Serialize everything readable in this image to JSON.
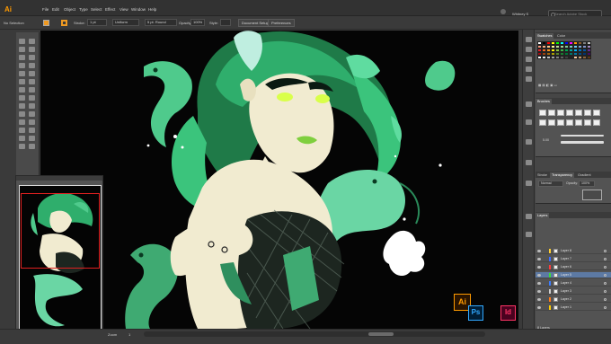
{
  "app": {
    "logo": "Ai"
  },
  "menu": [
    "File",
    "Edit",
    "Object",
    "Type",
    "Select",
    "Effect",
    "View",
    "Window",
    "Help"
  ],
  "header": {
    "user": "Whitney S",
    "search_placeholder": "Search Adobe Stock"
  },
  "control_bar": {
    "selection": "No Selection",
    "stroke_label": "Stroke:",
    "stroke_value": "1 pt",
    "profile": "Uniform",
    "brush": "5 pt. Round",
    "opacity_label": "Opacity:",
    "opacity_value": "100%",
    "style_label": "Style:",
    "doc_setup": "Document Setup",
    "preferences": "Preferences"
  },
  "panels": {
    "swatches_tabs": [
      "Swatches",
      "Color"
    ],
    "brushes_tabs": [
      "Brushes"
    ],
    "brush_size": "5.00",
    "transparency_tabs": [
      "Stroke",
      "Transparency",
      "Gradient"
    ],
    "blend_mode": "Normal",
    "opacity_label": "Opacity:",
    "opacity_value": "100%",
    "layers_tab": "Layers",
    "layers": [
      {
        "name": "Layer 8",
        "color": "#ffcf33",
        "selected": false
      },
      {
        "name": "Layer 7",
        "color": "#3d6dff",
        "selected": false
      },
      {
        "name": "Layer 6",
        "color": "#ff3c3c",
        "selected": false
      },
      {
        "name": "Layer 5",
        "color": "#3bdc3b",
        "selected": true
      },
      {
        "name": "Layer 4",
        "color": "#3c7dff",
        "selected": false
      },
      {
        "name": "Layer 3",
        "color": "#cfcfcf",
        "selected": false
      },
      {
        "name": "Layer 2",
        "color": "#ff7a1a",
        "selected": false
      },
      {
        "name": "Layer 1",
        "color": "#ffcc00",
        "selected": false
      }
    ],
    "layers_count": "8 Layers"
  },
  "status": {
    "zoom": "Zoom",
    "page": "1"
  },
  "badges": {
    "ai": "Ai",
    "ps": "Ps",
    "id": "Id"
  },
  "colors": {
    "accent": "#f09a22",
    "hair_green": "#2fae6c",
    "skin": "#f1ebd0",
    "serpent": "#4fca8c",
    "eye_glow": "#d9ff4a"
  }
}
